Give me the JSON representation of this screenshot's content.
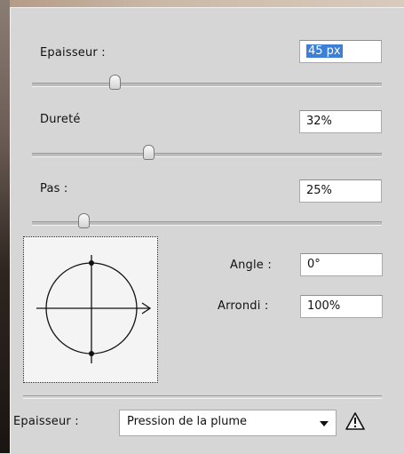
{
  "brush": {
    "size": {
      "label": "Epaisseur :",
      "value": "45 px",
      "slider_fraction": 0.24
    },
    "hardness": {
      "label": "Dureté",
      "value": "32%",
      "slider_fraction": 0.32
    },
    "spacing": {
      "label": "Pas :",
      "value": "25%",
      "slider_fraction": 0.13
    },
    "angle": {
      "label": "Angle :",
      "value": "0°"
    },
    "roundness": {
      "label": "Arrondi :",
      "value": "100%"
    }
  },
  "control": {
    "label": "Epaisseur :",
    "selected": "Pression de la plume"
  },
  "icons": {
    "preview": "brush-tip-preview-icon",
    "warning": "warning-triangle-icon",
    "dropdown": "chevron-down-icon"
  },
  "colors": {
    "selection": "#3b7fd6",
    "panel": "#d6d6d6"
  }
}
